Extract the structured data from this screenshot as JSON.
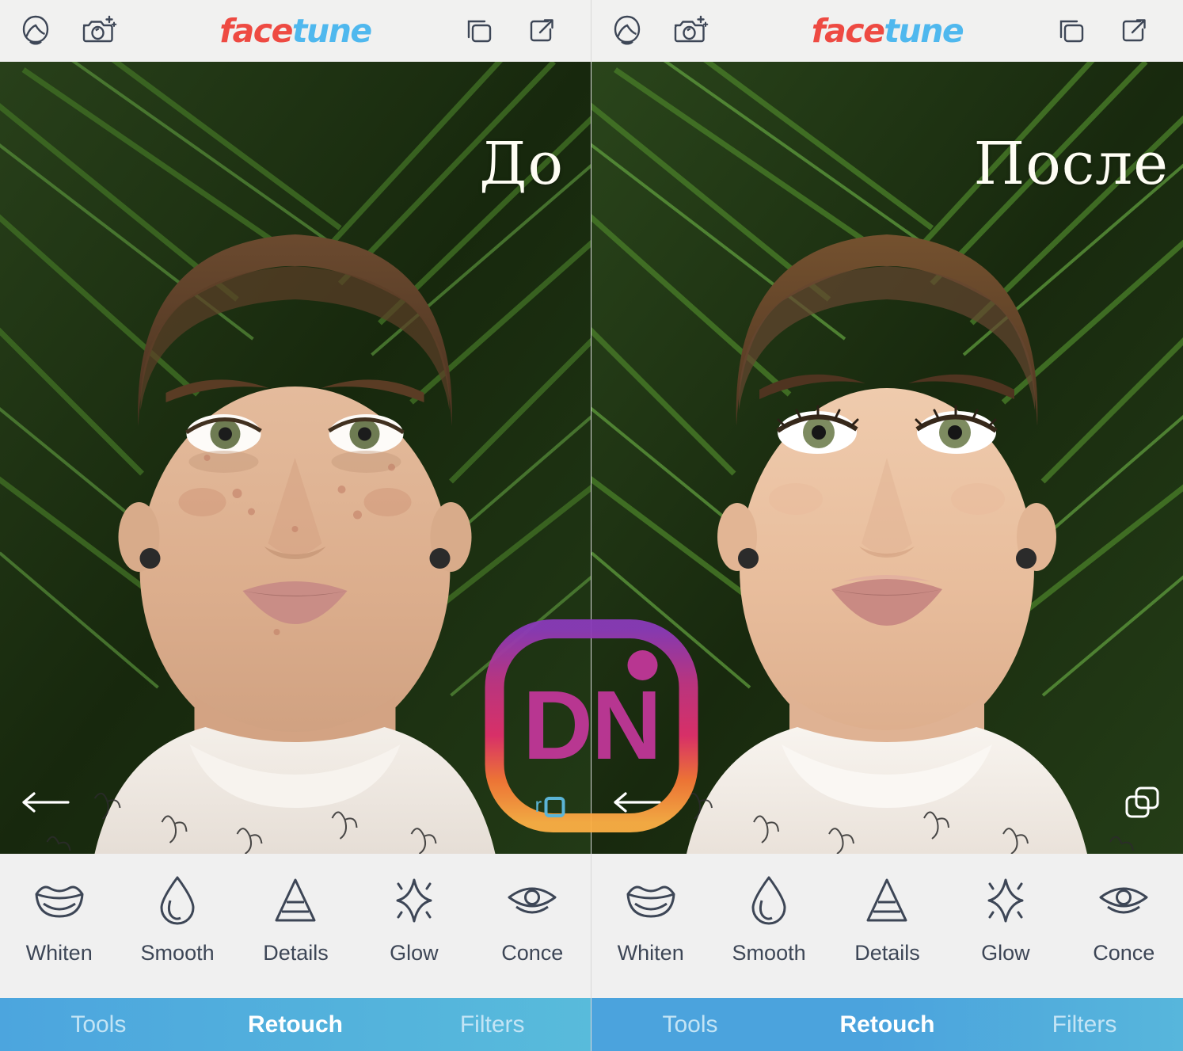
{
  "app": {
    "brand_face": "face",
    "brand_tune": "tune",
    "brand_face_color": "#EE4A42",
    "brand_tune_color": "#4FB8EE",
    "header_bg": "#F1F1F0",
    "toolbar_bg": "#F0F0F0",
    "tabbar_gradient_from": "#4CA5DE",
    "tabbar_gradient_to": "#58BBDB"
  },
  "header": {
    "icons_left": [
      {
        "name": "portrait-face-icon",
        "label": "Portrait"
      },
      {
        "name": "camera-sparkle-icon",
        "label": "Camera"
      }
    ],
    "icons_right": [
      {
        "name": "layers-copy-icon",
        "label": "Layers"
      },
      {
        "name": "share-export-icon",
        "label": "Share"
      }
    ]
  },
  "panels": [
    {
      "id": "before",
      "label": "До",
      "photo_alt": "Portrait of a woman in front of green palm fronds, unretouched",
      "back_arrow": "back-arrow-icon",
      "compare_icon": "compare-layers-icon"
    },
    {
      "id": "after",
      "label": "После",
      "photo_alt": "Portrait of a woman in front of green palm fronds, retouched",
      "back_arrow": "back-arrow-icon",
      "compare_icon": "compare-layers-icon"
    }
  ],
  "toolbar": {
    "tools": [
      {
        "id": "whiten",
        "label": "Whiten",
        "icon": "lips-smile-icon"
      },
      {
        "id": "smooth",
        "label": "Smooth",
        "icon": "water-droplet-icon"
      },
      {
        "id": "details",
        "label": "Details",
        "icon": "triangle-layers-icon"
      },
      {
        "id": "glow",
        "label": "Glow",
        "icon": "sparkle-star-icon"
      },
      {
        "id": "conceal",
        "label": "Conce",
        "icon": "eye-icon"
      }
    ]
  },
  "tabbar": {
    "tabs": [
      {
        "id": "tools",
        "label": "Tools",
        "active": false
      },
      {
        "id": "retouch",
        "label": "Retouch",
        "active": true
      },
      {
        "id": "filters",
        "label": "Filters",
        "active": false
      }
    ]
  },
  "watermark": {
    "text": "DN",
    "sub_text": "r",
    "color": "#C5379C",
    "frame_gradient": [
      "#8A3AB9",
      "#C13584",
      "#E1306C",
      "#F77737",
      "#FCAF45"
    ]
  }
}
